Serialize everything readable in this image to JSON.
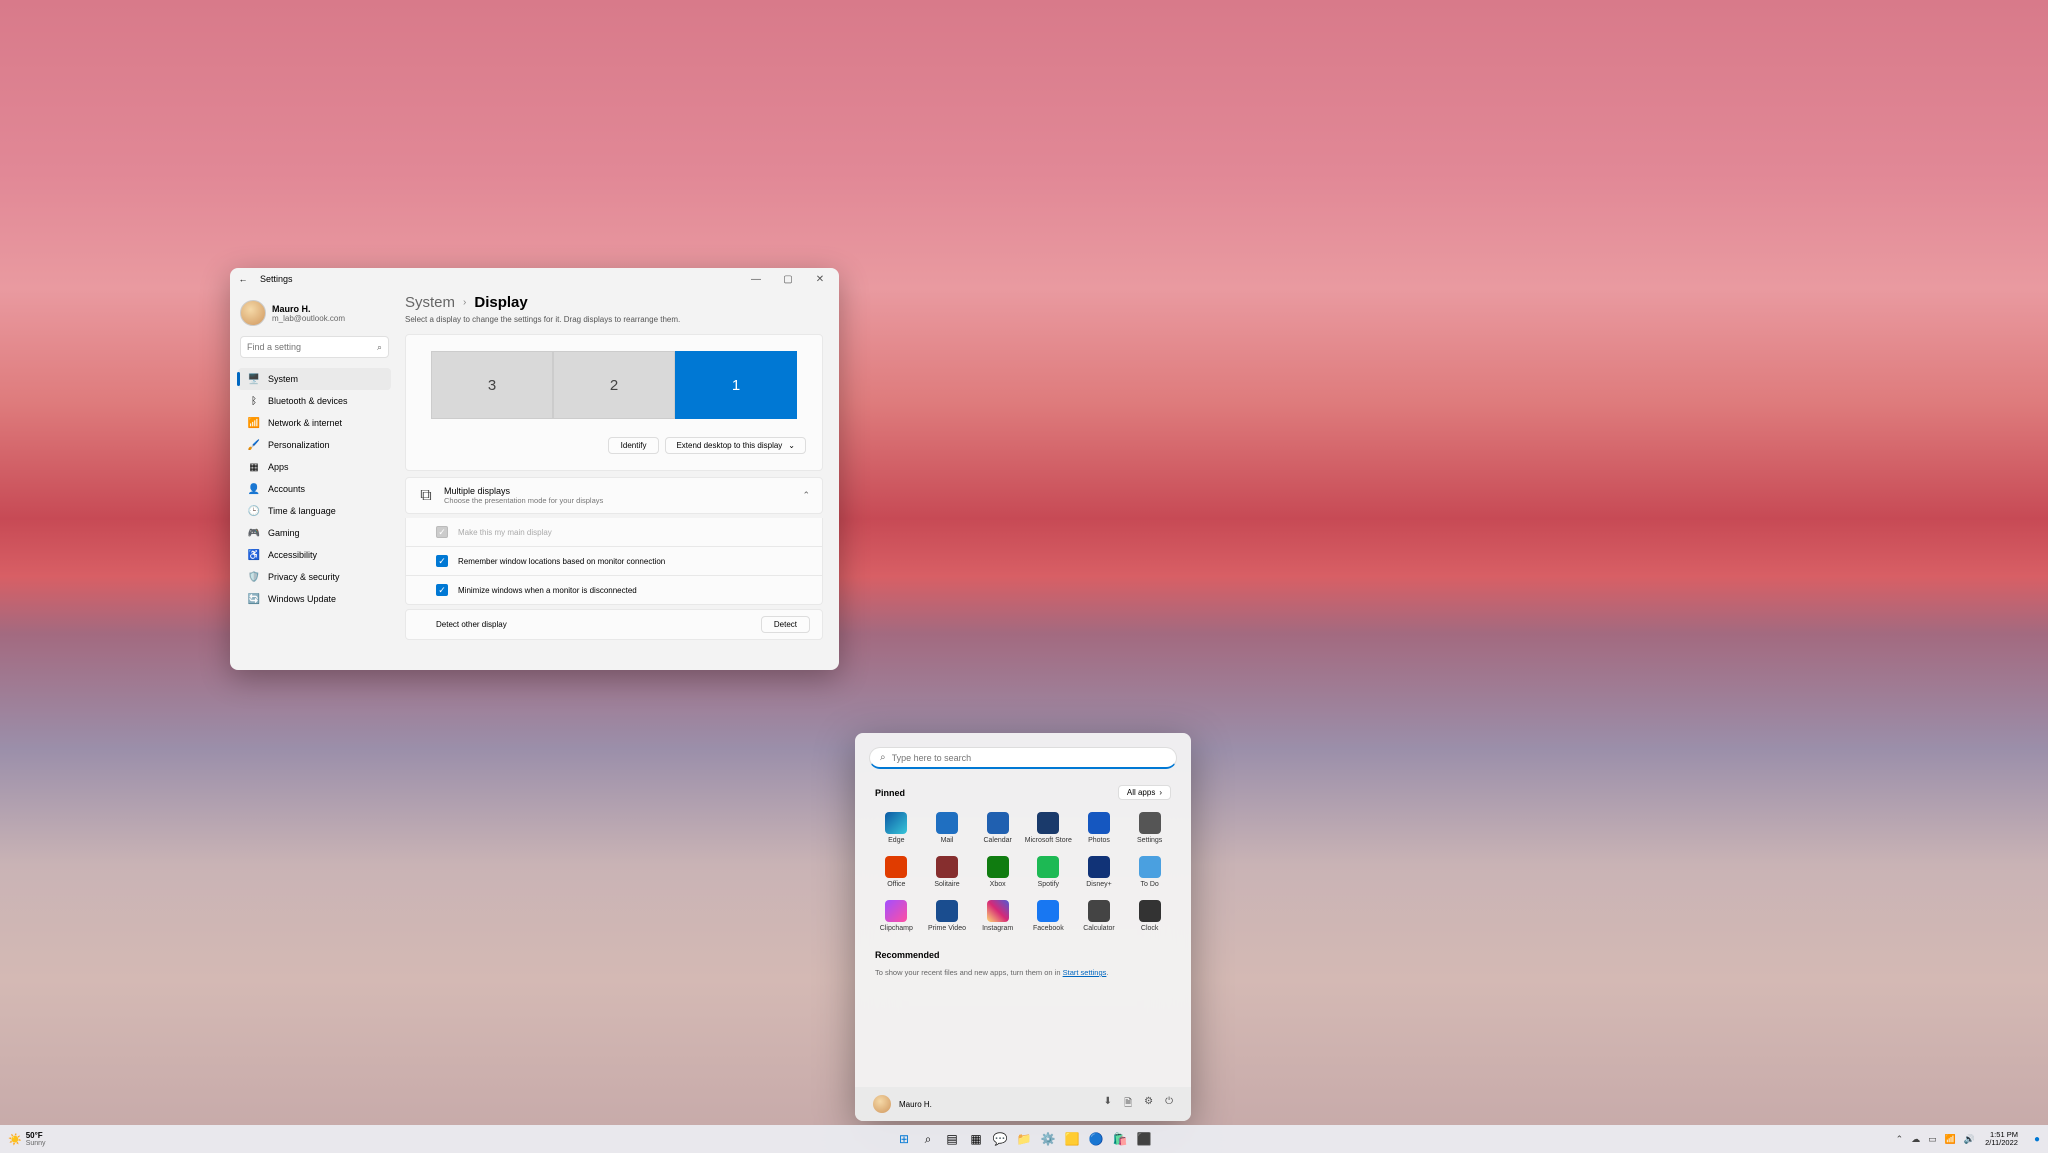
{
  "settings": {
    "title": "Settings",
    "user": {
      "name": "Mauro H.",
      "email": "m_lab@outlook.com"
    },
    "search_placeholder": "Find a setting",
    "nav": [
      {
        "label": "System",
        "icon": "🖥️",
        "active": true
      },
      {
        "label": "Bluetooth & devices",
        "icon": "ᛒ"
      },
      {
        "label": "Network & internet",
        "icon": "📶"
      },
      {
        "label": "Personalization",
        "icon": "🖌️"
      },
      {
        "label": "Apps",
        "icon": "▦"
      },
      {
        "label": "Accounts",
        "icon": "👤"
      },
      {
        "label": "Time & language",
        "icon": "🕒"
      },
      {
        "label": "Gaming",
        "icon": "🎮"
      },
      {
        "label": "Accessibility",
        "icon": "♿"
      },
      {
        "label": "Privacy & security",
        "icon": "🛡️"
      },
      {
        "label": "Windows Update",
        "icon": "🔄"
      }
    ],
    "breadcrumb": {
      "root": "System",
      "current": "Display"
    },
    "hint": "Select a display to change the settings for it. Drag displays to rearrange them.",
    "displays": [
      {
        "id": "3",
        "selected": false
      },
      {
        "id": "2",
        "selected": false
      },
      {
        "id": "1",
        "selected": true
      }
    ],
    "identify_label": "Identify",
    "extend_label": "Extend desktop to this display",
    "multi": {
      "title": "Multiple displays",
      "sub": "Choose the presentation mode for your displays"
    },
    "opts": {
      "make_main": "Make this my main display",
      "remember": "Remember window locations based on monitor connection",
      "minimize": "Minimize windows when a monitor is disconnected",
      "detect_other": "Detect other display",
      "detect_btn": "Detect"
    }
  },
  "start": {
    "search_placeholder": "Type here to search",
    "pinned_title": "Pinned",
    "all_apps_label": "All apps",
    "apps": [
      {
        "label": "Edge",
        "cls": "ic-edge"
      },
      {
        "label": "Mail",
        "cls": "ic-mail"
      },
      {
        "label": "Calendar",
        "cls": "ic-cal"
      },
      {
        "label": "Microsoft Store",
        "cls": "ic-store"
      },
      {
        "label": "Photos",
        "cls": "ic-photos"
      },
      {
        "label": "Settings",
        "cls": "ic-settings"
      },
      {
        "label": "Office",
        "cls": "ic-office"
      },
      {
        "label": "Solitaire",
        "cls": "ic-solitaire"
      },
      {
        "label": "Xbox",
        "cls": "ic-xbox"
      },
      {
        "label": "Spotify",
        "cls": "ic-spotify"
      },
      {
        "label": "Disney+",
        "cls": "ic-disney"
      },
      {
        "label": "To Do",
        "cls": "ic-todo"
      },
      {
        "label": "Clipchamp",
        "cls": "ic-clip"
      },
      {
        "label": "Prime Video",
        "cls": "ic-prime"
      },
      {
        "label": "Instagram",
        "cls": "ic-insta"
      },
      {
        "label": "Facebook",
        "cls": "ic-fb"
      },
      {
        "label": "Calculator",
        "cls": "ic-calc"
      },
      {
        "label": "Clock",
        "cls": "ic-clock"
      }
    ],
    "recommended_title": "Recommended",
    "recommended_text": "To show your recent files and new apps, turn them on in ",
    "recommended_link": "Start settings",
    "footer_user": "Mauro H."
  },
  "taskbar": {
    "weather": {
      "temp": "50°F",
      "cond": "Sunny"
    },
    "time": "1:51 PM",
    "date": "2/11/2022"
  }
}
